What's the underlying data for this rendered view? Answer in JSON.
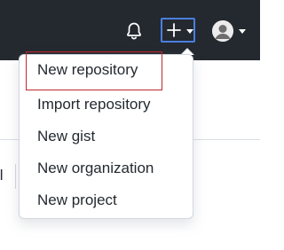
{
  "header": {
    "notifications_icon": "bell-icon",
    "create_icon": "plus-icon",
    "create_menu_caret_icon": "caret-down-icon",
    "avatar_icon": "avatar",
    "avatar_caret_icon": "caret-down-icon",
    "accent_color": "#4a7fe0",
    "background_color": "#24292f"
  },
  "create_menu": {
    "items": [
      {
        "label": "New repository",
        "highlighted": true
      },
      {
        "label": "Import repository"
      },
      {
        "label": "New gist"
      },
      {
        "label": "New organization"
      },
      {
        "label": "New project"
      }
    ],
    "highlight_color": "#c0282d"
  },
  "background": {
    "fragment_text": "ll"
  }
}
